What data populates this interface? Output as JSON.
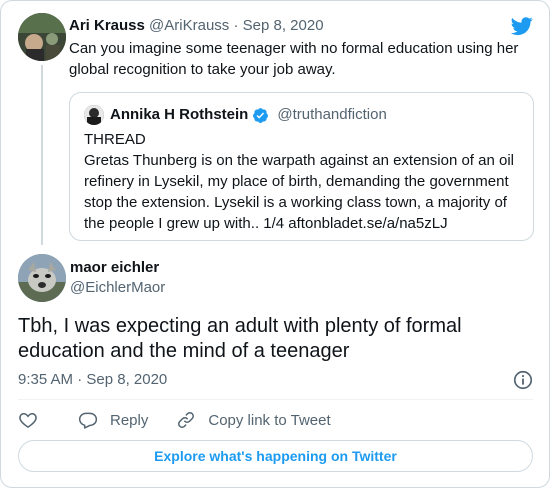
{
  "parent_tweet": {
    "name": "Ari Krauss",
    "handle": "@AriKrauss",
    "separator": "·",
    "date": "Sep 8, 2020",
    "text": "Can you imagine some teenager with no formal education using her global recognition to take your job away."
  },
  "quoted_tweet": {
    "name": "Annika H Rothstein",
    "handle": "@truthandfiction",
    "verified": true,
    "text_lines": [
      "THREAD",
      "Gretas Thunberg is on the warpath against an extension of an oil refinery in Lysekil, my place of birth, demanding the government stop the extension. Lysekil is a working class town, a majority of the people I grew up with.. 1/4 aftonbladet.se/a/na5zLJ"
    ]
  },
  "main_tweet": {
    "name": "maor eichler",
    "handle": "@EichlerMaor",
    "text": "Tbh, I was expecting an adult with plenty of formal education and the mind of a teenager",
    "timestamp": "9:35 AM · Sep 8, 2020"
  },
  "actions": {
    "reply_label": "Reply",
    "copy_link_label": "Copy link to Tweet"
  },
  "explore_label": "Explore what's happening on Twitter",
  "colors": {
    "accent": "#1d9bf0",
    "text": "#0f1419",
    "muted": "#536471",
    "border": "#cfd9de"
  },
  "icons": [
    "twitter-bird-icon",
    "verified-badge-icon",
    "info-icon",
    "heart-icon",
    "reply-icon",
    "link-icon"
  ]
}
